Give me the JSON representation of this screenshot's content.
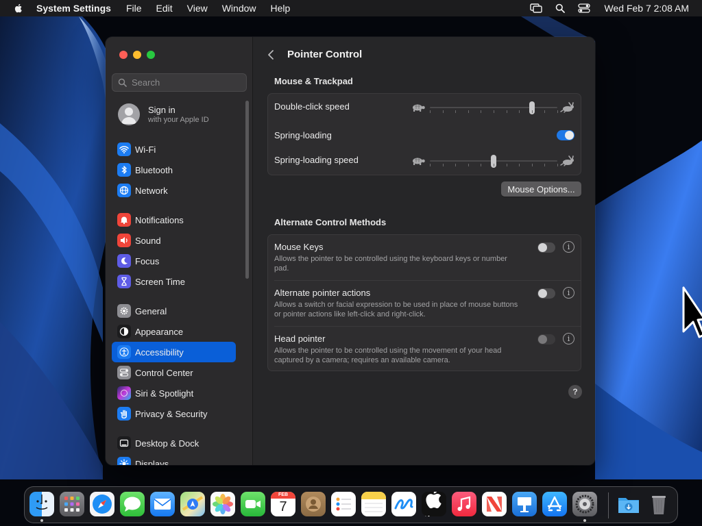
{
  "menubar": {
    "app_name": "System Settings",
    "menus": [
      "File",
      "Edit",
      "View",
      "Window",
      "Help"
    ],
    "clock": "Wed Feb 7  2:08 AM",
    "status_icons": [
      "screen-mirroring-icon",
      "spotlight-search-icon",
      "control-center-icon"
    ]
  },
  "sidebar": {
    "search_placeholder": "Search",
    "signin": {
      "title": "Sign in",
      "subtitle": "with your Apple ID"
    },
    "items": [
      {
        "label": "Wi-Fi",
        "icon": "wifi-icon",
        "color": "#1c7cf2"
      },
      {
        "label": "Bluetooth",
        "icon": "bluetooth-icon",
        "color": "#1c7cf2"
      },
      {
        "label": "Network",
        "icon": "globe-icon",
        "color": "#1c7cf2"
      },
      {
        "label": "Notifications",
        "icon": "bell-icon",
        "color": "#f0453a"
      },
      {
        "label": "Sound",
        "icon": "speaker-icon",
        "color": "#f0453a"
      },
      {
        "label": "Focus",
        "icon": "moon-icon",
        "color": "#5e5ce6"
      },
      {
        "label": "Screen Time",
        "icon": "hourglass-icon",
        "color": "#5e5ce6"
      },
      {
        "label": "General",
        "icon": "gear-icon",
        "color": "#8e8e93"
      },
      {
        "label": "Appearance",
        "icon": "appearance-icon",
        "color": "#1c1c1e"
      },
      {
        "label": "Accessibility",
        "icon": "accessibility-icon",
        "color": "#1c7cf2"
      },
      {
        "label": "Control Center",
        "icon": "control-center-icon",
        "color": "#8e8e93"
      },
      {
        "label": "Siri & Spotlight",
        "icon": "siri-icon",
        "color": "#6a3ad8"
      },
      {
        "label": "Privacy & Security",
        "icon": "hand-icon",
        "color": "#1c7cf2"
      },
      {
        "label": "Desktop & Dock",
        "icon": "dock-icon",
        "color": "#1c1c1e"
      },
      {
        "label": "Displays",
        "icon": "sun-icon",
        "color": "#1c7cf2"
      }
    ],
    "active_item": "Accessibility"
  },
  "main": {
    "title": "Pointer Control",
    "mouse_trackpad": {
      "heading": "Mouse & Trackpad",
      "double_click_label": "Double-click speed",
      "double_click_value": 0.8,
      "spring_loading_label": "Spring-loading",
      "spring_loading_on": true,
      "spring_speed_label": "Spring-loading speed",
      "spring_speed_value": 0.5,
      "options_button": "Mouse Options..."
    },
    "alternate": {
      "heading": "Alternate Control Methods",
      "mouse_keys": {
        "label": "Mouse Keys",
        "desc": "Allows the pointer to be controlled using the keyboard keys or number pad.",
        "on": false
      },
      "alt_pointer": {
        "label": "Alternate pointer actions",
        "desc": "Allows a switch or facial expression to be used in place of mouse buttons or pointer actions like left-click and right-click.",
        "on": false
      },
      "head_pointer": {
        "label": "Head pointer",
        "desc": "Allows the pointer to be controlled using the movement of your head captured by a camera; requires an available camera.",
        "on": false,
        "disabled": true
      }
    },
    "help_glyph": "?",
    "info_glyph": "i"
  },
  "dock": {
    "apps": [
      "Finder",
      "Launchpad",
      "Safari",
      "Messages",
      "Mail",
      "Maps",
      "Photos",
      "FaceTime",
      "Calendar",
      "Contacts",
      "Reminders",
      "Notes",
      "Freeform",
      "TV",
      "Music",
      "News",
      "Keynote",
      "App Store",
      "System Settings"
    ],
    "calendar_month": "FEB",
    "calendar_day": "7",
    "tv_label": "tv",
    "extras": [
      "Downloads",
      "Trash"
    ]
  }
}
